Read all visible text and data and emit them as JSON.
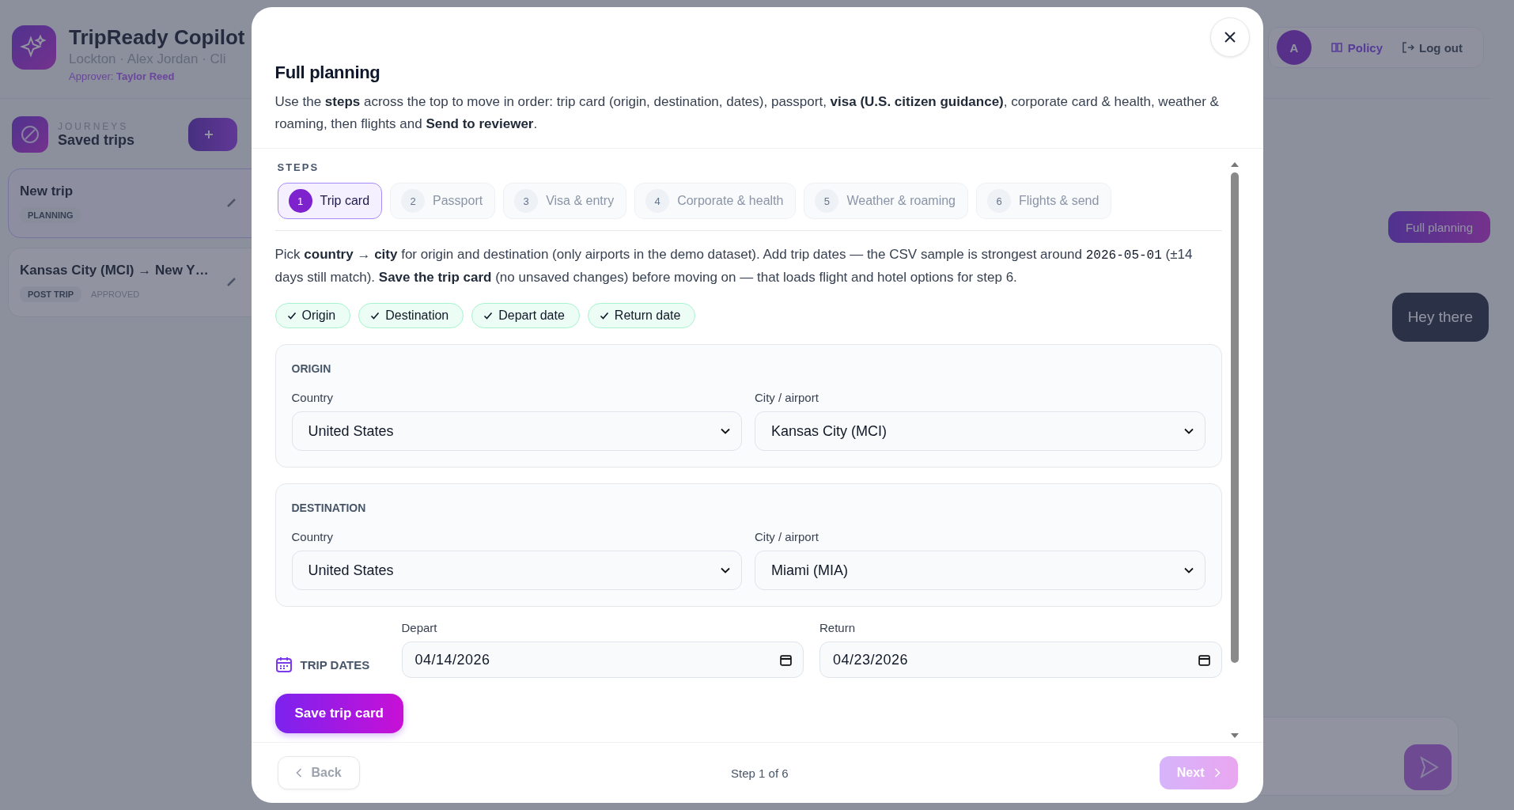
{
  "background": {
    "app_title": "TripReady Copilot",
    "subtitle": "Lockton · Alex Jordan · Cli",
    "approver_label": "Approver:",
    "approver_name": "Taylor Reed",
    "avatar": "A",
    "policy": "Policy",
    "logout": "Log out",
    "journeys_label": "JOURNEYS",
    "journeys_title": "Saved trips",
    "trips": [
      {
        "title": "New trip",
        "status": "PLANNING",
        "selected": true
      },
      {
        "title": "Kansas City (MCI) → New Y…",
        "status": "POST TRIP",
        "approval": "APPROVED",
        "selected": false
      }
    ],
    "full_planning_button": "Full planning",
    "chat_bubble": "Hey there"
  },
  "modal": {
    "title": "Full planning",
    "intro": "Use the **steps** across the top to move in order: trip card (origin, destination, dates), passport, **visa (U.S. citizen guidance)**, corporate card & health, weather & roaming, then flights and **Send to reviewer**.",
    "steps_label": "STEPS",
    "steps": [
      {
        "number": "1",
        "label": "Trip card",
        "selected": true
      },
      {
        "number": "2",
        "label": "Passport",
        "selected": false
      },
      {
        "number": "3",
        "label": "Visa & entry",
        "selected": false
      },
      {
        "number": "4",
        "label": "Corporate & health",
        "selected": false
      },
      {
        "number": "5",
        "label": "Weather & roaming",
        "selected": false
      },
      {
        "number": "6",
        "label": "Flights & send",
        "selected": false
      }
    ],
    "instructions_before": "Pick **country** → **city** for origin and destination (only airports in the demo dataset). Add trip dates — the CSV sample is strongest around",
    "instructions_code": "2026-05-01",
    "instructions_after": "(±14 days still match). **Save the trip card** (no unsaved changes) before moving on — that loads flight and hotel options for step 6.",
    "checks": [
      {
        "label": "Origin",
        "done": true
      },
      {
        "label": "Destination",
        "done": true
      },
      {
        "label": "Depart date",
        "done": true
      },
      {
        "label": "Return date",
        "done": true
      }
    ],
    "places": [
      {
        "heading": "ORIGIN",
        "country_label": "Country",
        "country": "United States",
        "city_label": "City / airport",
        "city": "Kansas City (MCI)"
      },
      {
        "heading": "DESTINATION",
        "country_label": "Country",
        "country": "United States",
        "city_label": "City / airport",
        "city": "Miami (MIA)"
      }
    ],
    "trip_dates": {
      "heading": "TRIP DATES",
      "depart_label": "Depart",
      "depart": "04/14/2026",
      "return_label": "Return",
      "return": "04/23/2026"
    },
    "save_button": "Save trip card",
    "footer": {
      "back": {
        "label": "Back",
        "disabled": true
      },
      "step_indicator": "Step 1 of 6",
      "next": {
        "label": "Next",
        "disabled": true
      }
    }
  }
}
